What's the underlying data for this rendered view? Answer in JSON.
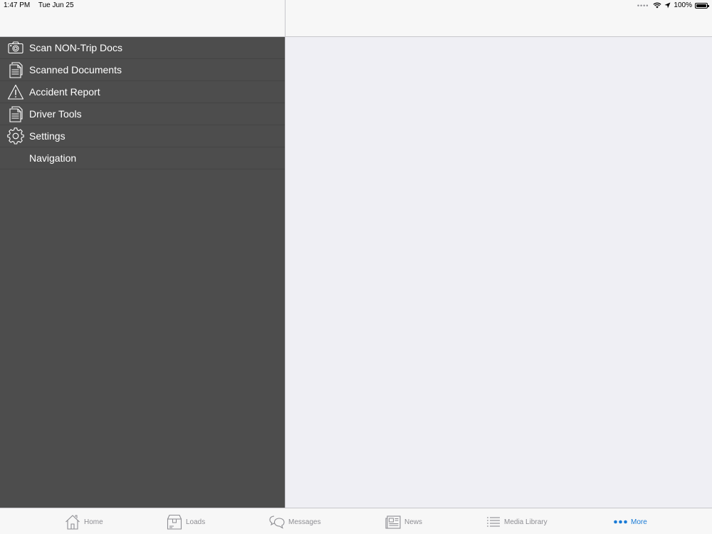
{
  "status_bar": {
    "time": "1:47 PM",
    "date": "Tue Jun 25",
    "battery": "100%",
    "battery_level": 1.0
  },
  "sidebar": {
    "items": [
      {
        "label": "Scan NON-Trip Docs",
        "icon": "camera-icon"
      },
      {
        "label": "Scanned Documents",
        "icon": "document-icon"
      },
      {
        "label": "Accident Report",
        "icon": "warning-icon"
      },
      {
        "label": "Driver Tools",
        "icon": "document-icon"
      },
      {
        "label": "Settings",
        "icon": "gear-icon"
      },
      {
        "label": "Navigation",
        "icon": ""
      }
    ]
  },
  "tab_bar": {
    "tabs": [
      {
        "label": "Home",
        "icon": "home-icon",
        "active": false
      },
      {
        "label": "Loads",
        "icon": "box-icon",
        "active": false
      },
      {
        "label": "Messages",
        "icon": "chat-bubbles-icon",
        "active": false
      },
      {
        "label": "News",
        "icon": "newspaper-icon",
        "active": false
      },
      {
        "label": "Media Library",
        "icon": "list-icon",
        "active": false
      },
      {
        "label": "More",
        "icon": "more-dots-icon",
        "active": true
      }
    ]
  },
  "colors": {
    "sidebar_bg": "#4d4d4d",
    "detail_bg": "#efeff4",
    "bar_bg": "#f7f7f7",
    "accent": "#1a7bd6",
    "tab_inactive": "#8e8e93"
  }
}
